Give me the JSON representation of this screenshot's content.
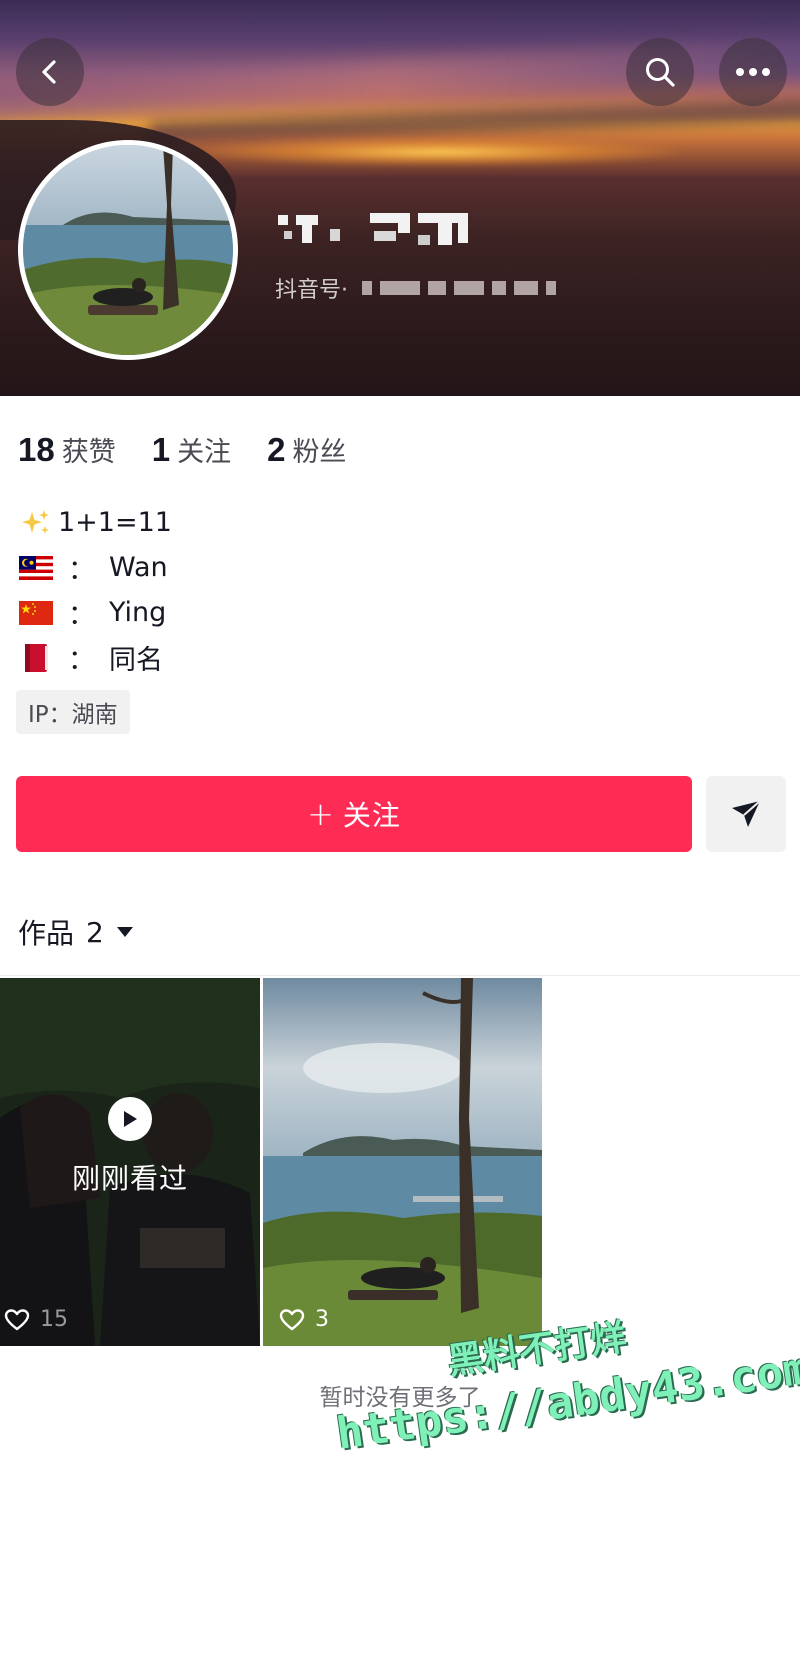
{
  "header": {
    "douyin_id_label": "抖音号·",
    "back_icon": "back-arrow-icon",
    "search_icon": "search-icon",
    "more_icon": "more-dots-icon"
  },
  "stats": [
    {
      "value": "18",
      "label": "获赞"
    },
    {
      "value": "1",
      "label": "关注"
    },
    {
      "value": "2",
      "label": "粉丝"
    }
  ],
  "bio": {
    "line1_icon": "sparkles-icon",
    "line1_text": "1+1=11",
    "line2_icon": "malaysia-flag-icon",
    "line2_sep": "：",
    "line2_text": "Wan",
    "line3_icon": "china-flag-icon",
    "line3_sep": "：",
    "line3_text": "Ying",
    "line4_icon": "red-book-icon",
    "line4_sep": "：",
    "line4_text": "同名"
  },
  "ip_tag": "IP：湖南",
  "actions": {
    "follow_plus": "+",
    "follow_label": "关注",
    "share_icon": "send-icon",
    "follow_color": "#fe2c55"
  },
  "works": {
    "label": "作品",
    "count": "2",
    "caret_icon": "caret-down-icon"
  },
  "videos": [
    {
      "overlay_label": "刚刚看过",
      "likes": "15",
      "play_icon": "play-icon"
    },
    {
      "likes": "3"
    }
  ],
  "footer": {
    "no_more_text": "暂时没有更多了"
  },
  "watermark": {
    "line1": "黑料不打烊",
    "line2": "https://abdy43.com"
  }
}
